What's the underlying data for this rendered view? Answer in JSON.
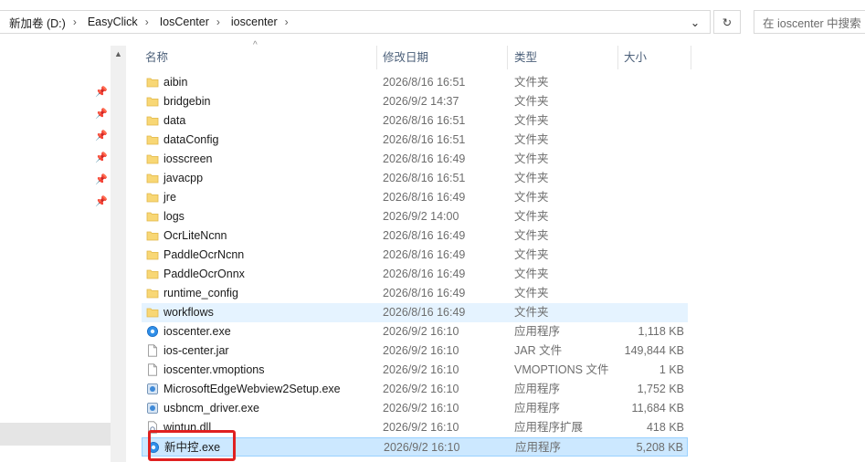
{
  "address": {
    "crumbs": [
      "新加卷 (D:)",
      "EasyClick",
      "IosCenter",
      "ioscenter"
    ],
    "separator": "›",
    "dropdown_glyph": "⌄",
    "refresh_glyph": "↻",
    "search_placeholder": "在 ioscenter 中搜索"
  },
  "columns": {
    "name": "名称",
    "date": "修改日期",
    "type": "类型",
    "size": "大小"
  },
  "files": [
    {
      "name": "aibin",
      "date": "2026/8/16 16:51",
      "type": "文件夹",
      "size": "",
      "icon": "folder-icon"
    },
    {
      "name": "bridgebin",
      "date": "2026/9/2 14:37",
      "type": "文件夹",
      "size": "",
      "icon": "folder-icon"
    },
    {
      "name": "data",
      "date": "2026/8/16 16:51",
      "type": "文件夹",
      "size": "",
      "icon": "folder-icon"
    },
    {
      "name": "dataConfig",
      "date": "2026/8/16 16:51",
      "type": "文件夹",
      "size": "",
      "icon": "folder-icon"
    },
    {
      "name": "iosscreen",
      "date": "2026/8/16 16:49",
      "type": "文件夹",
      "size": "",
      "icon": "folder-icon"
    },
    {
      "name": "javacpp",
      "date": "2026/8/16 16:51",
      "type": "文件夹",
      "size": "",
      "icon": "folder-icon"
    },
    {
      "name": "jre",
      "date": "2026/8/16 16:49",
      "type": "文件夹",
      "size": "",
      "icon": "folder-icon"
    },
    {
      "name": "logs",
      "date": "2026/9/2 14:00",
      "type": "文件夹",
      "size": "",
      "icon": "folder-icon"
    },
    {
      "name": "OcrLiteNcnn",
      "date": "2026/8/16 16:49",
      "type": "文件夹",
      "size": "",
      "icon": "folder-icon"
    },
    {
      "name": "PaddleOcrNcnn",
      "date": "2026/8/16 16:49",
      "type": "文件夹",
      "size": "",
      "icon": "folder-icon"
    },
    {
      "name": "PaddleOcrOnnx",
      "date": "2026/8/16 16:49",
      "type": "文件夹",
      "size": "",
      "icon": "folder-icon"
    },
    {
      "name": "runtime_config",
      "date": "2026/8/16 16:49",
      "type": "文件夹",
      "size": "",
      "icon": "folder-icon"
    },
    {
      "name": "workflows",
      "date": "2026/8/16 16:49",
      "type": "文件夹",
      "size": "",
      "icon": "folder-icon"
    },
    {
      "name": "ioscenter.exe",
      "date": "2026/9/2 16:10",
      "type": "应用程序",
      "size": "1,118 KB",
      "icon": "app-icon"
    },
    {
      "name": "ios-center.jar",
      "date": "2026/9/2 16:10",
      "type": "JAR 文件",
      "size": "149,844 KB",
      "icon": "file-icon"
    },
    {
      "name": "ioscenter.vmoptions",
      "date": "2026/9/2 16:10",
      "type": "VMOPTIONS 文件",
      "size": "1 KB",
      "icon": "file-icon"
    },
    {
      "name": "MicrosoftEdgeWebview2Setup.exe",
      "date": "2026/9/2 16:10",
      "type": "应用程序",
      "size": "1,752 KB",
      "icon": "installer-icon"
    },
    {
      "name": "usbncm_driver.exe",
      "date": "2026/9/2 16:10",
      "type": "应用程序",
      "size": "11,684 KB",
      "icon": "installer-icon"
    },
    {
      "name": "wintun.dll",
      "date": "2026/9/2 16:10",
      "type": "应用程序扩展",
      "size": "418 KB",
      "icon": "dll-icon"
    },
    {
      "name": "新中控.exe",
      "date": "2026/9/2 16:10",
      "type": "应用程序",
      "size": "5,208 KB",
      "icon": "app-icon"
    }
  ],
  "hover_row": "workflows",
  "selected_row": "新中控.exe",
  "colors": {
    "selected_bg": "#cce8ff",
    "hover_bg": "#e5f3ff",
    "highlight_border": "#e02020",
    "folder": "#f8d775"
  }
}
